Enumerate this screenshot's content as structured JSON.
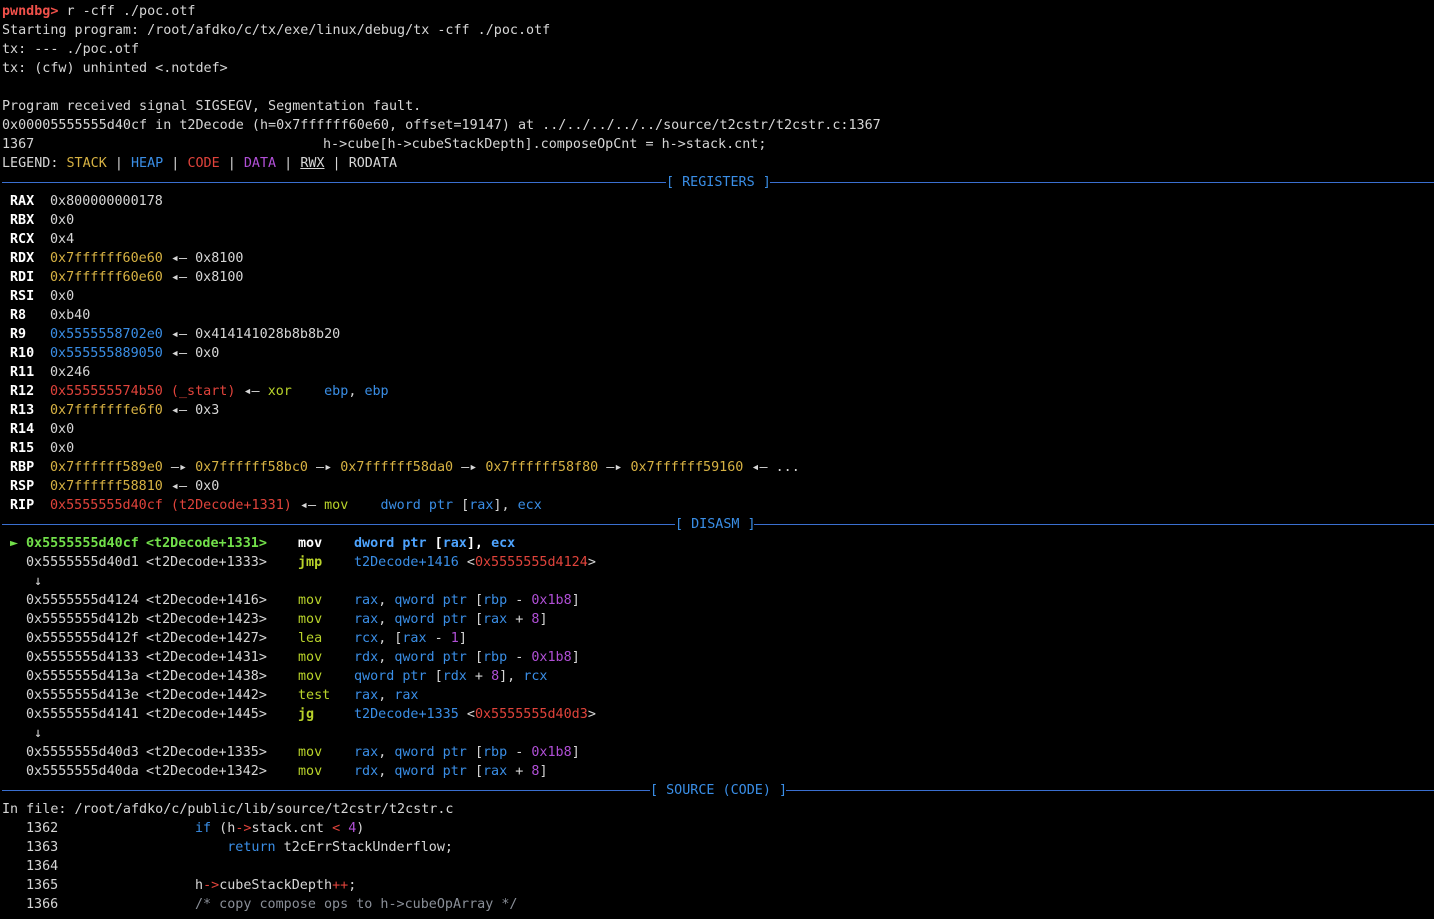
{
  "terminal": {
    "prompt": "pwndbg>",
    "command": " r -cff ./poc.otf",
    "program_start": "Starting program: /root/afdko/c/tx/exe/linux/debug/tx -cff ./poc.otf",
    "tx_line1": "tx: --- ./poc.otf",
    "tx_line2": "tx: (cfw) unhinted <.notdef>",
    "signal_line": "Program received signal SIGSEGV, Segmentation fault.",
    "frame_line": "0x00005555555d40cf in t2Decode (h=0x7ffffff60e60, offset=19147) at ../../../../../source/t2cstr/t2cstr.c:1367",
    "src_line_no": "1367",
    "src_line_text": "\t\th->cube[h->cubeStackDepth].composeOpCnt = h->stack.cnt;",
    "legend": {
      "prefix": "LEGEND: ",
      "stack": "STACK",
      "heap": "HEAP",
      "code": "CODE",
      "data": "DATA",
      "rwx": "RWX",
      "rodata": "RODATA",
      "sep": " | "
    }
  },
  "sections": {
    "registers": "[ REGISTERS ]",
    "disasm": "[ DISASM ]",
    "source": "[ SOURCE (CODE) ]"
  },
  "registers": [
    {
      "name": "RAX",
      "parts": [
        [
          "w",
          "0x800000000178"
        ]
      ]
    },
    {
      "name": "RBX",
      "parts": [
        [
          "w",
          "0x0"
        ]
      ]
    },
    {
      "name": "RCX",
      "parts": [
        [
          "w",
          "0x4"
        ]
      ]
    },
    {
      "name": "RDX",
      "parts": [
        [
          "y",
          "0x7ffffff60e60"
        ],
        [
          "w",
          " ◂— 0x8100"
        ]
      ]
    },
    {
      "name": "RDI",
      "parts": [
        [
          "y",
          "0x7ffffff60e60"
        ],
        [
          "w",
          " ◂— 0x8100"
        ]
      ]
    },
    {
      "name": "RSI",
      "parts": [
        [
          "w",
          "0x0"
        ]
      ]
    },
    {
      "name": "R8",
      "parts": [
        [
          "w",
          "0xb40"
        ]
      ]
    },
    {
      "name": "R9",
      "parts": [
        [
          "b",
          "0x5555558702e0"
        ],
        [
          "w",
          " ◂— 0x414141028b8b8b20"
        ]
      ]
    },
    {
      "name": "R10",
      "parts": [
        [
          "b",
          "0x555555889050"
        ],
        [
          "w",
          " ◂— 0x0"
        ]
      ]
    },
    {
      "name": "R11",
      "parts": [
        [
          "w",
          "0x246"
        ]
      ]
    },
    {
      "name": "R12",
      "parts": [
        [
          "red",
          "0x555555574b50 (_start)"
        ],
        [
          "w",
          " ◂— "
        ],
        [
          "yg",
          "xor"
        ],
        [
          "w",
          "    "
        ],
        [
          "b",
          "ebp"
        ],
        [
          "w",
          ", "
        ],
        [
          "b",
          "ebp"
        ]
      ]
    },
    {
      "name": "R13",
      "parts": [
        [
          "y",
          "0x7fffffffe6f0"
        ],
        [
          "w",
          " ◂— 0x3"
        ]
      ]
    },
    {
      "name": "R14",
      "parts": [
        [
          "w",
          "0x0"
        ]
      ]
    },
    {
      "name": "R15",
      "parts": [
        [
          "w",
          "0x0"
        ]
      ]
    },
    {
      "name": "RBP",
      "parts": [
        [
          "y",
          "0x7ffffff589e0"
        ],
        [
          "w",
          " —▸ "
        ],
        [
          "y",
          "0x7ffffff58bc0"
        ],
        [
          "w",
          " —▸ "
        ],
        [
          "y",
          "0x7ffffff58da0"
        ],
        [
          "w",
          " —▸ "
        ],
        [
          "y",
          "0x7ffffff58f80"
        ],
        [
          "w",
          " —▸ "
        ],
        [
          "y",
          "0x7ffffff59160"
        ],
        [
          "w",
          " ◂— ..."
        ]
      ]
    },
    {
      "name": "RSP",
      "parts": [
        [
          "y",
          "0x7ffffff58810"
        ],
        [
          "w",
          " ◂— 0x0"
        ]
      ]
    },
    {
      "name": "RIP",
      "parts": [
        [
          "red",
          "0x5555555d40cf (t2Decode+1331)"
        ],
        [
          "w",
          " ◂— "
        ],
        [
          "yg",
          "mov"
        ],
        [
          "w",
          "    "
        ],
        [
          "b",
          "dword ptr "
        ],
        [
          "w",
          "["
        ],
        [
          "b",
          "rax"
        ],
        [
          "w",
          "], "
        ],
        [
          "b",
          "ecx"
        ]
      ]
    }
  ],
  "disasm": [
    {
      "kind": "ins",
      "current": true,
      "addr": "0x5555555d40cf",
      "sym": "<t2Decode+1331>",
      "op": "mov",
      "args": [
        [
          "bw",
          "dword ptr "
        ],
        [
          "bw",
          "["
        ],
        [
          "bw",
          "rax"
        ],
        [
          "bw",
          "], "
        ],
        [
          "bw",
          "ecx"
        ]
      ]
    },
    {
      "kind": "ins",
      "addr": "0x5555555d40d1",
      "sym": "<t2Decode+1333>",
      "op": "jmp",
      "opbold": true,
      "args": [
        [
          "b",
          "t2Decode+1416 "
        ],
        [
          "w",
          "<"
        ],
        [
          "red",
          "0x5555555d4124"
        ],
        [
          "w",
          ">"
        ]
      ]
    },
    {
      "kind": "arrow",
      "text": "↓"
    },
    {
      "kind": "ins",
      "addr": "0x5555555d4124",
      "sym": "<t2Decode+1416>",
      "op": "mov",
      "args": [
        [
          "b",
          "rax"
        ],
        [
          "w",
          ", "
        ],
        [
          "b",
          "qword ptr "
        ],
        [
          "w",
          "["
        ],
        [
          "b",
          "rbp"
        ],
        [
          "w",
          " - "
        ],
        [
          "m",
          "0x1b8"
        ],
        [
          "w",
          "]"
        ]
      ]
    },
    {
      "kind": "ins",
      "addr": "0x5555555d412b",
      "sym": "<t2Decode+1423>",
      "op": "mov",
      "args": [
        [
          "b",
          "rax"
        ],
        [
          "w",
          ", "
        ],
        [
          "b",
          "qword ptr "
        ],
        [
          "w",
          "["
        ],
        [
          "b",
          "rax"
        ],
        [
          "w",
          " + "
        ],
        [
          "m",
          "8"
        ],
        [
          "w",
          "]"
        ]
      ]
    },
    {
      "kind": "ins",
      "addr": "0x5555555d412f",
      "sym": "<t2Decode+1427>",
      "op": "lea",
      "args": [
        [
          "b",
          "rcx"
        ],
        [
          "w",
          ", ["
        ],
        [
          "b",
          "rax"
        ],
        [
          "w",
          " - "
        ],
        [
          "m",
          "1"
        ],
        [
          "w",
          "]"
        ]
      ]
    },
    {
      "kind": "ins",
      "addr": "0x5555555d4133",
      "sym": "<t2Decode+1431>",
      "op": "mov",
      "args": [
        [
          "b",
          "rdx"
        ],
        [
          "w",
          ", "
        ],
        [
          "b",
          "qword ptr "
        ],
        [
          "w",
          "["
        ],
        [
          "b",
          "rbp"
        ],
        [
          "w",
          " - "
        ],
        [
          "m",
          "0x1b8"
        ],
        [
          "w",
          "]"
        ]
      ]
    },
    {
      "kind": "ins",
      "addr": "0x5555555d413a",
      "sym": "<t2Decode+1438>",
      "op": "mov",
      "args": [
        [
          "b",
          "qword ptr "
        ],
        [
          "w",
          "["
        ],
        [
          "b",
          "rdx"
        ],
        [
          "w",
          " + "
        ],
        [
          "m",
          "8"
        ],
        [
          "w",
          "], "
        ],
        [
          "b",
          "rcx"
        ]
      ]
    },
    {
      "kind": "ins",
      "addr": "0x5555555d413e",
      "sym": "<t2Decode+1442>",
      "op": "test",
      "args": [
        [
          "b",
          "rax"
        ],
        [
          "w",
          ", "
        ],
        [
          "b",
          "rax"
        ]
      ]
    },
    {
      "kind": "ins",
      "addr": "0x5555555d4141",
      "sym": "<t2Decode+1445>",
      "op": "jg",
      "opbold": true,
      "args": [
        [
          "b",
          "t2Decode+1335 "
        ],
        [
          "w",
          "<"
        ],
        [
          "red",
          "0x5555555d40d3"
        ],
        [
          "w",
          ">"
        ]
      ]
    },
    {
      "kind": "arrow",
      "text": "↓"
    },
    {
      "kind": "ins",
      "addr": "0x5555555d40d3",
      "sym": "<t2Decode+1335>",
      "op": "mov",
      "args": [
        [
          "b",
          "rax"
        ],
        [
          "w",
          ", "
        ],
        [
          "b",
          "qword ptr "
        ],
        [
          "w",
          "["
        ],
        [
          "b",
          "rbp"
        ],
        [
          "w",
          " - "
        ],
        [
          "m",
          "0x1b8"
        ],
        [
          "w",
          "]"
        ]
      ]
    },
    {
      "kind": "ins",
      "addr": "0x5555555d40da",
      "sym": "<t2Decode+1342>",
      "op": "mov",
      "args": [
        [
          "b",
          "rdx"
        ],
        [
          "w",
          ", "
        ],
        [
          "b",
          "qword ptr "
        ],
        [
          "w",
          "["
        ],
        [
          "b",
          "rax"
        ],
        [
          "w",
          " + "
        ],
        [
          "m",
          "8"
        ],
        [
          "w",
          "]"
        ]
      ]
    }
  ],
  "source": {
    "in_file": "In file: /root/afdko/c/public/lib/source/t2cstr/t2cstr.c",
    "lines": [
      {
        "no": "1362",
        "parts": [
          [
            "w",
            "                "
          ],
          [
            "b",
            "if"
          ],
          [
            "w",
            " (h"
          ],
          [
            "red",
            "->"
          ],
          [
            "w",
            "stack.cnt "
          ],
          [
            "red",
            "<"
          ],
          [
            "w",
            " "
          ],
          [
            "m",
            "4"
          ],
          [
            "w",
            ")"
          ]
        ]
      },
      {
        "no": "1363",
        "parts": [
          [
            "w",
            "                    "
          ],
          [
            "b",
            "return"
          ],
          [
            "w",
            " t2cErrStackUnderflow;"
          ]
        ]
      },
      {
        "no": "1364",
        "parts": []
      },
      {
        "no": "1365",
        "parts": [
          [
            "w",
            "                h"
          ],
          [
            "red",
            "->"
          ],
          [
            "w",
            "cubeStackDepth"
          ],
          [
            "red",
            "++"
          ],
          [
            "w",
            ";"
          ]
        ]
      },
      {
        "no": "1366",
        "parts": [
          [
            "w",
            "                "
          ],
          [
            "cm",
            "/* copy compose ops to h->cubeOpArray */"
          ]
        ]
      }
    ]
  },
  "colors": {
    "background": "#000000",
    "text": "#d6d6d6",
    "prompt": "#e0433b",
    "stack": "#d7b243",
    "heap": "#3a8ee6",
    "code": "#e0433b",
    "data": "#b04fd6",
    "current_instruction": "#72e04a",
    "mnemonic": "#b8d22a",
    "rule": "#3a6fd0"
  }
}
